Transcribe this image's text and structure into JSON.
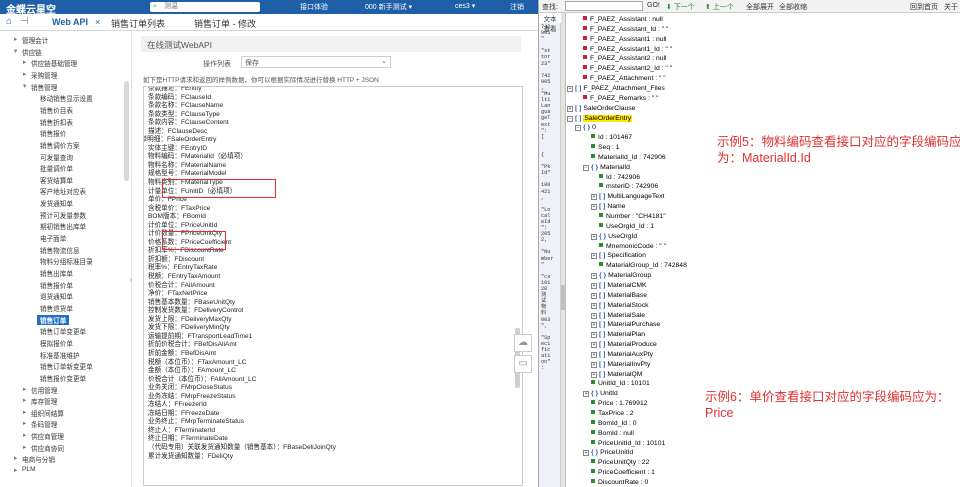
{
  "topbar": {
    "logo": "金蝶云星空",
    "search_placeholder": "测温",
    "links": [
      "接口体验",
      "000 新手测试 ▾",
      "ces3 ▾",
      "注销"
    ]
  },
  "tabs": [
    "Web API",
    "销售订单列表",
    "销售订单 - 修改"
  ],
  "sidebar": [
    {
      "label": "管理会计",
      "exp": "▸",
      "indent": 0
    },
    {
      "label": "供应链",
      "exp": "▾",
      "indent": 0
    },
    {
      "label": "供应链基础管理",
      "exp": "▸",
      "indent": 1
    },
    {
      "label": "采购管理",
      "exp": "▸",
      "indent": 1
    },
    {
      "label": "销售管理",
      "exp": "▾",
      "indent": 1
    },
    {
      "label": "移动销售显示设置",
      "exp": "",
      "indent": 2
    },
    {
      "label": "销售价目表",
      "exp": "",
      "indent": 2
    },
    {
      "label": "销售折扣表",
      "exp": "",
      "indent": 2
    },
    {
      "label": "销售报价",
      "exp": "",
      "indent": 2
    },
    {
      "label": "销售调价方案",
      "exp": "",
      "indent": 2
    },
    {
      "label": "可发量查询",
      "exp": "",
      "indent": 2
    },
    {
      "label": "批量调价单",
      "exp": "",
      "indent": 2
    },
    {
      "label": "客货结算单",
      "exp": "",
      "indent": 2
    },
    {
      "label": "客户地址对应表",
      "exp": "",
      "indent": 2
    },
    {
      "label": "发货通知单",
      "exp": "",
      "indent": 2
    },
    {
      "label": "预计可发量参数",
      "exp": "",
      "indent": 2
    },
    {
      "label": "期初销售出库单",
      "exp": "",
      "indent": 2
    },
    {
      "label": "电子面单",
      "exp": "",
      "indent": 2
    },
    {
      "label": "销售物流信息",
      "exp": "",
      "indent": 2
    },
    {
      "label": "物料分组标准目录",
      "exp": "",
      "indent": 2
    },
    {
      "label": "销售出库单",
      "exp": "",
      "indent": 2
    },
    {
      "label": "销售报价单",
      "exp": "",
      "indent": 2
    },
    {
      "label": "退货通知单",
      "exp": "",
      "indent": 2
    },
    {
      "label": "销售退货单",
      "exp": "",
      "indent": 2
    },
    {
      "label": "销售订单",
      "exp": "",
      "indent": 2,
      "selected": true
    },
    {
      "label": "销售订单变更单",
      "exp": "",
      "indent": 2
    },
    {
      "label": "模拟报价单",
      "exp": "",
      "indent": 2
    },
    {
      "label": "标准基准维护",
      "exp": "",
      "indent": 2
    },
    {
      "label": "销售订单新变更单",
      "exp": "",
      "indent": 2
    },
    {
      "label": "销售报价变更单",
      "exp": "",
      "indent": 2
    },
    {
      "label": "信用管理",
      "exp": "▸",
      "indent": 1
    },
    {
      "label": "库存管理",
      "exp": "▸",
      "indent": 1
    },
    {
      "label": "组织间结算",
      "exp": "▸",
      "indent": 1
    },
    {
      "label": "条码管理",
      "exp": "▸",
      "indent": 1
    },
    {
      "label": "供应商管理",
      "exp": "▸",
      "indent": 1
    },
    {
      "label": "供应商协同",
      "exp": "▸",
      "indent": 1
    },
    {
      "label": "电商与分销",
      "exp": "▸",
      "indent": 0
    },
    {
      "label": "PLM",
      "exp": "▸",
      "indent": 0
    }
  ],
  "main": {
    "title": "在线测试WebAPI",
    "op_label": "操作列表",
    "op_value": "保存",
    "description": "如下是HTTP请求和返回的样例数据，你可以根据实际情况进行替换  HTTP + JSON",
    "collapse_glyph": "‹",
    "code_lines": [
      "条款描述：FEntity",
      "条款编码：FClauseId",
      "条款名称：FClauseName",
      "条款类型：FClauseType",
      "条款内容：FClauseContent",
      "描述：FClauseDesc",
      "订单明细：FSaleOrderEntry",
      "实体主键：FEntryID",
      "物料编码：FMaterialId（必填项）",
      "物料名称：FMaterialName",
      "规格型号：FMaterialModel",
      "物料类别：FMaterialType",
      "计量单位：FUnitID（必填项）",
      "单价：FPrice",
      "含税单价：FTaxPrice",
      "BOM版本：FBomId",
      "计价单位：FPriceUnitId",
      "计价数量：FPriceUnitQty",
      "价格系数：FPriceCoefficient",
      "折扣率%：FDiscountRate",
      "折扣额：FDiscount",
      "税率%：FEntryTaxRate",
      "税额：FEntryTaxAmount",
      "价税合计：FAllAmount",
      "净价：FTaxNetPrice",
      "销售基本数量：FBaseUnitQty",
      "控制发货数量：FDeliveryControl",
      "发货上限：FDeliveryMaxQty",
      "发货下限：FDeliveryMinQty",
      "运输提前期：FTransportLeadTime1",
      "折前价税合计：FBefDisAllAmt",
      "折前金额：FBefDisAmt",
      "税额（本位币）：FTaxAmount_LC",
      "金额（本位币）：FAmount_LC",
      "价税合计（本位币）：FAllAmount_LC",
      "业务关闭：FMrpCloseStatus",
      "业务冻结：FMrpFreezeStatus",
      "冻结人：FFreezerId",
      "冻结日期：FFreezeDate",
      "业务终止：FMrpTerminateStatus",
      "终止人：FTerminaterId",
      "终止日期：FTerminateDate",
      "（代码专用）关联发货通知数量（销售基本）：FBaseDeliJoinQty",
      "累计发货通知数量：FDeliQty"
    ]
  },
  "viewer": {
    "toolbar": {
      "find_label": "查找:",
      "go": "GO!",
      "down": "⬇ 下一个",
      "up": "⬆ 上一个",
      "expand": "全部展开",
      "collapse": "全部收缩",
      "back": "回到首页",
      "about": "关于"
    },
    "tabs": [
      "文本",
      "查看"
    ],
    "raw_lines": [
      "742",
      "905",
      "\"",
      "",
      "\"st",
      "tor",
      "23\"",
      "",
      "742",
      "905",
      ",",
      "\"Mu",
      "lti",
      "Lan",
      "gua",
      "geT",
      "ext",
      "\":",
      "[",
      "",
      "",
      "{",
      "",
      "\"Pk",
      "Id\"",
      "",
      "100",
      "421",
      ",",
      "",
      "\"Lo",
      "cal",
      "eId",
      "\":",
      "205",
      "2,",
      "",
      "\"Nu",
      "mber",
      "\"",
      "",
      "\"cs",
      "101",
      "20",
      "测",
      "试",
      "物",
      "料",
      "003",
      "\",",
      "",
      "\"Sp",
      "eci",
      "fic",
      "ati",
      "on\"",
      ":"
    ],
    "tree": [
      {
        "t": "F_PAEZ_Assistant : null",
        "l": 1,
        "k": "red"
      },
      {
        "t": "F_PAEZ_Assistant_Id : \" \"",
        "l": 1,
        "k": "red"
      },
      {
        "t": "F_PAEZ_Assistant1 : null",
        "l": 1,
        "k": "red"
      },
      {
        "t": "F_PAEZ_Assistant1_Id : \" \"",
        "l": 1,
        "k": "red"
      },
      {
        "t": "F_PAEZ_Assistant2 : null",
        "l": 1,
        "k": "red"
      },
      {
        "t": "F_PAEZ_Assistant2_Id : \" \"",
        "l": 1,
        "k": "red"
      },
      {
        "t": "F_PAEZ_Attachment : \" \"",
        "l": 1,
        "k": "red"
      },
      {
        "t": "F_PAEZ_Attachment_Files",
        "l": 0,
        "k": "arr",
        "e": "+"
      },
      {
        "t": "F_PAEZ_Remarks : \" \"",
        "l": 1,
        "k": "red"
      },
      {
        "t": "SaleOrderClause",
        "l": 0,
        "k": "arr",
        "e": "+"
      },
      {
        "t": "SaleOrderEntry",
        "l": 0,
        "k": "arr",
        "e": "−",
        "hl": true
      },
      {
        "t": "0",
        "l": 1,
        "k": "obj",
        "e": "−"
      },
      {
        "t": "Id : 101467",
        "l": 2,
        "k": "grn"
      },
      {
        "t": "Seq : 1",
        "l": 2,
        "k": "grn"
      },
      {
        "t": "MaterialId_Id : 742906",
        "l": 2,
        "k": "grn"
      },
      {
        "t": "MaterialId",
        "l": 2,
        "k": "obj",
        "e": "−"
      },
      {
        "t": "Id : 742906",
        "l": 3,
        "k": "grn"
      },
      {
        "t": "msterID : 742906",
        "l": 3,
        "k": "grn"
      },
      {
        "t": "MultiLanguageText",
        "l": 3,
        "k": "arr",
        "e": "+"
      },
      {
        "t": "Name",
        "l": 3,
        "k": "arr",
        "e": "+"
      },
      {
        "t": "Number : \"CH4181\"",
        "l": 3,
        "k": "grn"
      },
      {
        "t": "UseOrgId_Id : 1",
        "l": 3,
        "k": "grn"
      },
      {
        "t": "UseOrgId",
        "l": 3,
        "k": "obj",
        "e": "+"
      },
      {
        "t": "MnemonicCode : \" \"",
        "l": 3,
        "k": "grn"
      },
      {
        "t": "Specification",
        "l": 3,
        "k": "arr",
        "e": "+"
      },
      {
        "t": "MaterialGroup_Id : 742848",
        "l": 3,
        "k": "grn"
      },
      {
        "t": "MaterialGroup",
        "l": 3,
        "k": "obj",
        "e": "+"
      },
      {
        "t": "MaterialCMK",
        "l": 3,
        "k": "arr",
        "e": "+"
      },
      {
        "t": "MaterialBase",
        "l": 3,
        "k": "arr",
        "e": "+"
      },
      {
        "t": "MaterialStock",
        "l": 3,
        "k": "arr",
        "e": "+"
      },
      {
        "t": "MaterialSale",
        "l": 3,
        "k": "arr",
        "e": "+"
      },
      {
        "t": "MaterialPurchase",
        "l": 3,
        "k": "arr",
        "e": "+"
      },
      {
        "t": "MaterialPlan",
        "l": 3,
        "k": "arr",
        "e": "+"
      },
      {
        "t": "MaterialProduce",
        "l": 3,
        "k": "arr",
        "e": "+"
      },
      {
        "t": "MaterialAuxPty",
        "l": 3,
        "k": "arr",
        "e": "+"
      },
      {
        "t": "MaterialInvPty",
        "l": 3,
        "k": "arr",
        "e": "+"
      },
      {
        "t": "MaterialQM",
        "l": 3,
        "k": "arr",
        "e": "+"
      },
      {
        "t": "UnitId_Id : 10101",
        "l": 2,
        "k": "grn"
      },
      {
        "t": "UnitId",
        "l": 2,
        "k": "obj",
        "e": "+"
      },
      {
        "t": "Price : 1.769912",
        "l": 2,
        "k": "grn"
      },
      {
        "t": "TaxPrice : 2",
        "l": 2,
        "k": "grn"
      },
      {
        "t": "BomId_Id : 0",
        "l": 2,
        "k": "grn"
      },
      {
        "t": "BomId : null",
        "l": 2,
        "k": "grn"
      },
      {
        "t": "PriceUnitId_Id : 10101",
        "l": 2,
        "k": "grn"
      },
      {
        "t": "PriceUnitId",
        "l": 2,
        "k": "obj",
        "e": "+"
      },
      {
        "t": "PriceUnitQty : 22",
        "l": 2,
        "k": "grn"
      },
      {
        "t": "PriceCoefficient : 1",
        "l": 2,
        "k": "grn"
      },
      {
        "t": "DiscountRate : 0",
        "l": 2,
        "k": "grn"
      }
    ],
    "annotations": [
      {
        "line1": "示例5：物料编码查看接口对应的字段编码应",
        "line2": "为：MaterialId.Id"
      },
      {
        "line1": "示例6：单价查看接口对应的字段编码应为：",
        "line2": "Price"
      }
    ]
  },
  "colors": {
    "accent": "#1e5fa8",
    "selected": "#1e6fc8",
    "annotation": "#e03030",
    "highlight": "#ffe800"
  }
}
